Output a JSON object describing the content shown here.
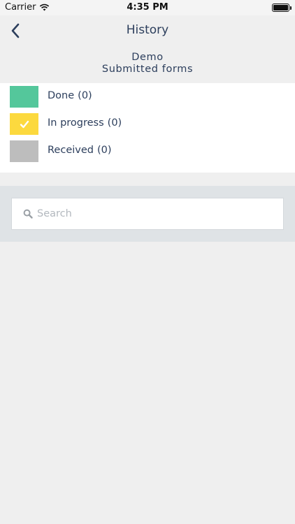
{
  "status_bar": {
    "carrier": "Carrier",
    "time": "4:35 PM"
  },
  "nav": {
    "back_icon": "chevron-left-icon",
    "title": "History"
  },
  "header": {
    "line1": "Demo",
    "line2": "Submitted forms"
  },
  "legend": {
    "items": [
      {
        "label": "Done",
        "count": "(0)",
        "color": "#54c79b",
        "checked": false
      },
      {
        "label": "In progress",
        "count": "(0)",
        "color": "#fcd93e",
        "checked": true
      },
      {
        "label": "Received",
        "count": "(0)",
        "color": "#bdbdbd",
        "checked": false
      }
    ]
  },
  "search": {
    "placeholder": "Search",
    "value": "",
    "icon": "search-icon"
  },
  "colors": {
    "accent": "#2c3e5c",
    "background": "#efefef",
    "search_area": "#dfe3e6"
  }
}
